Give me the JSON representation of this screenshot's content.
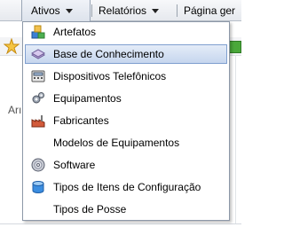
{
  "menubar": {
    "items": [
      {
        "label": "Ativos",
        "active": true
      },
      {
        "label": "Relatórios",
        "active": false
      },
      {
        "label": "Página ger",
        "active": false
      }
    ]
  },
  "background": {
    "partial_label": "Arı"
  },
  "dropdown": {
    "items": [
      {
        "label": "Artefatos",
        "icon": "artifacts-icon"
      },
      {
        "label": "Base de Conhecimento",
        "icon": "knowledge-base-icon",
        "highlighted": true
      },
      {
        "label": "Dispositivos Telefônicos",
        "icon": "phone-device-icon"
      },
      {
        "label": "Equipamentos",
        "icon": "gears-icon"
      },
      {
        "label": "Fabricantes",
        "icon": "factory-icon"
      },
      {
        "label": "Modelos de Equipamentos",
        "icon": null
      },
      {
        "label": "Software",
        "icon": "cd-icon"
      },
      {
        "label": "Tipos de Itens de Configuração",
        "icon": "database-icon"
      },
      {
        "label": "Tipos de Posse",
        "icon": null
      }
    ]
  },
  "colors": {
    "highlight_border": "#7f9fcf",
    "highlight_fill": "#c6d6ee",
    "menu_border": "#8d98a8"
  }
}
